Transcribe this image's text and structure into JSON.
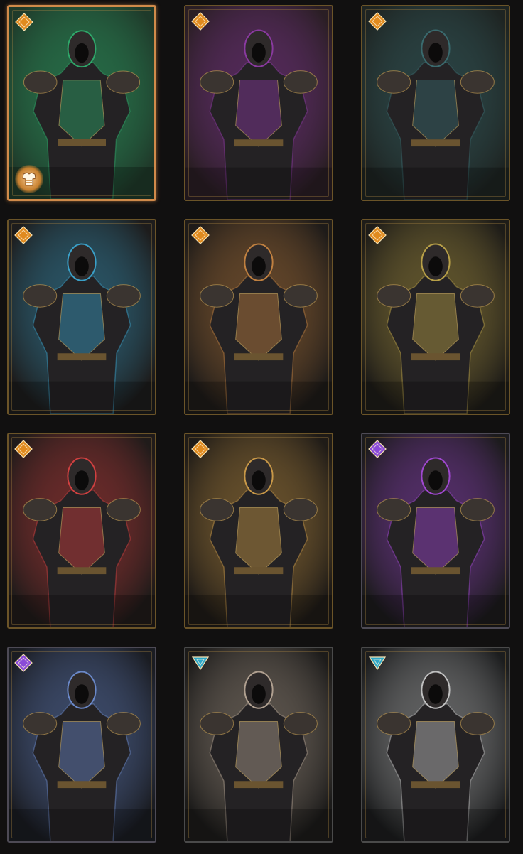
{
  "page": {
    "background": "#111010"
  },
  "rarity_colors": {
    "legendary": "#e08a1e",
    "mythic": "#8a4ad8",
    "rare": "#2fa8c8"
  },
  "cards": [
    {
      "id": "card-1",
      "rarity": "legendary",
      "selected": true,
      "equipped": true,
      "bg": "#1f3a2a",
      "accent": "#2fa86a",
      "figure": "hooded-sorceress"
    },
    {
      "id": "card-2",
      "rarity": "legendary",
      "selected": false,
      "equipped": false,
      "bg": "#2a1e24",
      "accent": "#8a3aa0",
      "figure": "horned-demoness"
    },
    {
      "id": "card-3",
      "rarity": "legendary",
      "selected": false,
      "equipped": false,
      "bg": "#1e2422",
      "accent": "#3a6a6e",
      "figure": "robed-warrior"
    },
    {
      "id": "card-4",
      "rarity": "legendary",
      "selected": false,
      "equipped": false,
      "bg": "#1d1c1c",
      "accent": "#3aa0c8",
      "figure": "frost-skull-armor"
    },
    {
      "id": "card-5",
      "rarity": "legendary",
      "selected": false,
      "equipped": false,
      "bg": "#1e1b19",
      "accent": "#c08040",
      "figure": "golden-helm-armor"
    },
    {
      "id": "card-6",
      "rarity": "legendary",
      "selected": false,
      "equipped": false,
      "bg": "#1e1c18",
      "accent": "#b8a048",
      "figure": "skull-hood-armor"
    },
    {
      "id": "card-7",
      "rarity": "legendary",
      "selected": false,
      "equipped": false,
      "bg": "#201b1a",
      "accent": "#d04040",
      "figure": "red-hood-armor"
    },
    {
      "id": "card-8",
      "rarity": "legendary",
      "selected": false,
      "equipped": false,
      "bg": "#1f1b17",
      "accent": "#c89848",
      "figure": "gold-knight-armor"
    },
    {
      "id": "card-9",
      "rarity": "mythic",
      "selected": false,
      "equipped": false,
      "bg": "#1c1b1d",
      "accent": "#a048d0",
      "figure": "beast-skull-armor"
    },
    {
      "id": "card-10",
      "rarity": "mythic",
      "selected": false,
      "equipped": false,
      "bg": "#1a1c22",
      "accent": "#6a88c8",
      "figure": "horned-shaman"
    },
    {
      "id": "card-11",
      "rarity": "rare",
      "selected": false,
      "equipped": false,
      "bg": "#1c1b1a",
      "accent": "#b0a090",
      "figure": "deer-skull-armor"
    },
    {
      "id": "card-12",
      "rarity": "rare",
      "selected": false,
      "equipped": false,
      "bg": "#1c1d1e",
      "accent": "#c0c0c0",
      "figure": "white-robed-warrior"
    }
  ]
}
